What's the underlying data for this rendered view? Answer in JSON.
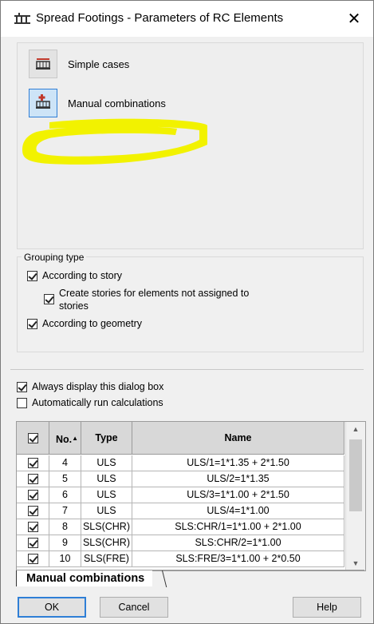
{
  "window": {
    "title": "Spread Footings - Parameters of RC Elements",
    "close_glyph": "✕"
  },
  "options": [
    {
      "label": "Simple cases",
      "icon": "simple-cases-icon",
      "selected": false
    },
    {
      "label": "Manual combinations",
      "icon": "manual-combinations-icon",
      "selected": true
    }
  ],
  "annotation": {
    "color": "#f2f200"
  },
  "grouping": {
    "title": "Grouping type",
    "according_to_story": {
      "label": "According to story",
      "checked": true
    },
    "create_stories": {
      "label_line1": "Create stories for elements not assigned to",
      "label_line2": "stories",
      "checked": true
    },
    "according_to_geometry": {
      "label": "According to geometry",
      "checked": true
    }
  },
  "always_display": {
    "label": "Always display this dialog box",
    "checked": true
  },
  "auto_run": {
    "label": "Automatically run calculations",
    "checked": false
  },
  "table": {
    "headers": {
      "no": "No.",
      "type": "Type",
      "name": "Name"
    },
    "header_checked": true,
    "rows": [
      {
        "checked": true,
        "no": "4",
        "type": "ULS",
        "name": "ULS/1=1*1.35 + 2*1.50"
      },
      {
        "checked": true,
        "no": "5",
        "type": "ULS",
        "name": "ULS/2=1*1.35"
      },
      {
        "checked": true,
        "no": "6",
        "type": "ULS",
        "name": "ULS/3=1*1.00 + 2*1.50"
      },
      {
        "checked": true,
        "no": "7",
        "type": "ULS",
        "name": "ULS/4=1*1.00"
      },
      {
        "checked": true,
        "no": "8",
        "type": "SLS(CHR)",
        "name": "SLS:CHR/1=1*1.00 + 2*1.00"
      },
      {
        "checked": true,
        "no": "9",
        "type": "SLS(CHR)",
        "name": "SLS:CHR/2=1*1.00"
      },
      {
        "checked": true,
        "no": "10",
        "type": "SLS(FRE)",
        "name": "SLS:FRE/3=1*1.00 + 2*0.50"
      }
    ]
  },
  "tab": {
    "label": "Manual combinations"
  },
  "buttons": {
    "ok": "OK",
    "cancel": "Cancel",
    "help": "Help"
  }
}
